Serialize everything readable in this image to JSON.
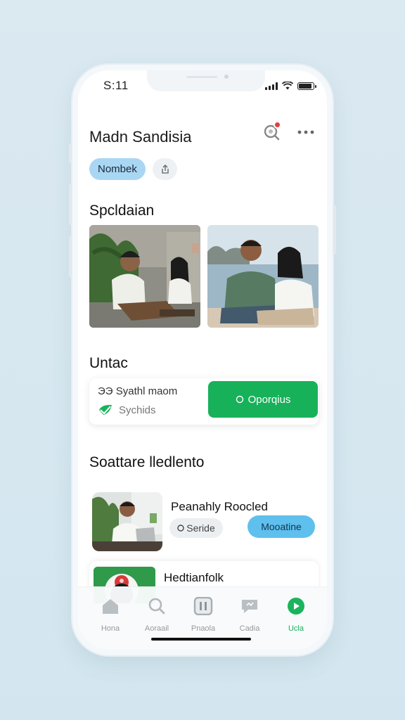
{
  "status_bar": {
    "time": "S:11",
    "battery": 0.9
  },
  "header": {
    "title": "Madn Sandisia",
    "search_icon": "search-icon",
    "notification_color": "#e73c3c",
    "more_icon": "more-icon"
  },
  "filters": {
    "active_pill": "Nombek",
    "second_chip_icon": "share-icon"
  },
  "sections": {
    "photos": {
      "title": "Spcldaian"
    },
    "info": {
      "title": "Untac",
      "line1_prefix": "ЭЭ",
      "line1": "Syathl maom",
      "line2": "Sychids",
      "button_label": "Oporqius",
      "button_icon": "check-icon"
    },
    "list": {
      "title": "Soattare lledlento",
      "item1": {
        "title": "Peanahly Roocled",
        "tag": "Seride",
        "tag_icon": "target-icon",
        "action_label": "Mooatine"
      },
      "item2": {
        "title": "Hedtianfolk"
      }
    }
  },
  "tabbar": {
    "items": [
      {
        "label": "Hona",
        "icon": "home-icon"
      },
      {
        "label": "Aoraail",
        "icon": "search-icon"
      },
      {
        "label": "Pnaola",
        "icon": "grid-icon"
      },
      {
        "label": "Cadia",
        "icon": "chat-icon"
      },
      {
        "label": "Ucla",
        "icon": "play-icon",
        "active": true
      }
    ]
  },
  "colors": {
    "accent_green": "#17b15a",
    "accent_blue": "#5fc0ee",
    "pill_blue": "#a9d6f3"
  }
}
